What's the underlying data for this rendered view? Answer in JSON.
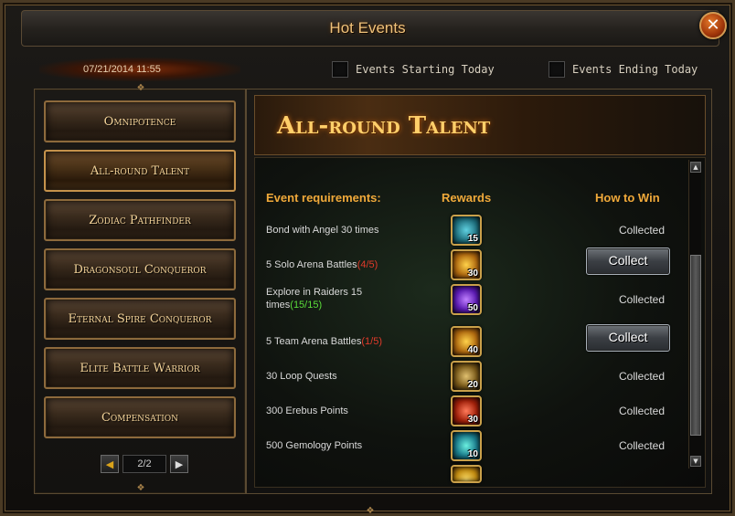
{
  "window": {
    "title": "Hot Events",
    "close_icon": "close-icon"
  },
  "date": "07/21/2014 11:55",
  "filters": [
    {
      "label": "Events Starting Today",
      "checked": false
    },
    {
      "label": "Events Ending Today",
      "checked": false
    }
  ],
  "menu": {
    "items": [
      {
        "label": "Omnipotence"
      },
      {
        "label": "All-round Talent",
        "active": true
      },
      {
        "label": "Zodiac Pathfinder"
      },
      {
        "label": "Dragonsoul Conqueror"
      },
      {
        "label": "Eternal Spire Conqueror"
      },
      {
        "label": "Elite Battle Warrior"
      },
      {
        "label": "Compensation"
      }
    ],
    "pager": "2/2"
  },
  "event": {
    "title": "All-round Talent",
    "headers": {
      "requirements": "Event requirements:",
      "rewards": "Rewards",
      "how_to_win": "How to Win"
    },
    "rows": [
      {
        "requirement": "Bond with Angel 30 times",
        "progress": "",
        "progress_color": "",
        "reward_qty": "15",
        "reward_color": "#1c6a78",
        "status": "Collected",
        "collect": false
      },
      {
        "requirement": "5 Solo Arena Battles",
        "progress": "(4/5)",
        "progress_color": "red",
        "reward_qty": "30",
        "reward_color": "#7a4a10",
        "status": "",
        "collect": true,
        "collect_label": "Collect"
      },
      {
        "requirement": "Explore in Raiders 15 times",
        "progress": "(15/15)",
        "progress_color": "green",
        "reward_qty": "50",
        "reward_color": "#3a1a7a",
        "status": "Collected",
        "collect": false
      },
      {
        "requirement": "5 Team Arena Battles",
        "progress": "(1/5)",
        "progress_color": "red",
        "reward_qty": "40",
        "reward_color": "#8a5a14",
        "status": "",
        "collect": true,
        "collect_label": "Collect"
      },
      {
        "requirement": "30 Loop Quests",
        "progress": "",
        "progress_color": "",
        "reward_qty": "20",
        "reward_color": "#6a4a1a",
        "status": "Collected",
        "collect": false
      },
      {
        "requirement": "300 Erebus Points",
        "progress": "",
        "progress_color": "",
        "reward_qty": "30",
        "reward_color": "#7a2010",
        "status": "Collected",
        "collect": false
      },
      {
        "requirement": "500 Gemology Points",
        "progress": "",
        "progress_color": "",
        "reward_qty": "10",
        "reward_color": "#1a5a6a",
        "status": "Collected",
        "collect": false
      }
    ]
  }
}
